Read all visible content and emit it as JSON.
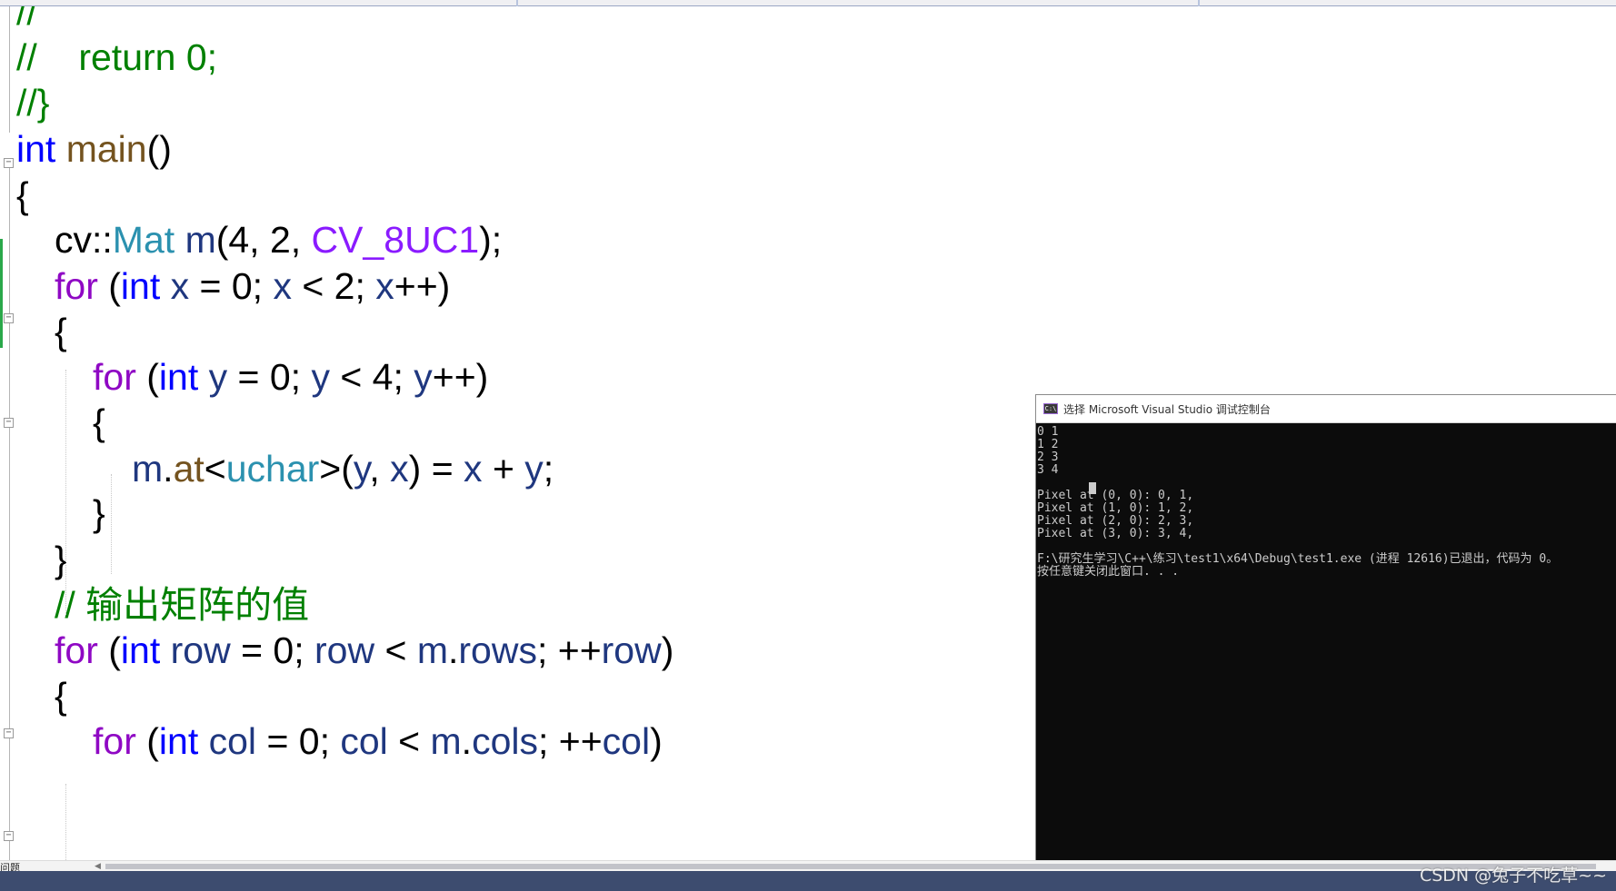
{
  "editor": {
    "lines": [
      [
        {
          "t": "//",
          "c": "cm"
        }
      ],
      [
        {
          "t": "//    return 0;",
          "c": "cm"
        }
      ],
      [
        {
          "t": "//}",
          "c": "cm"
        }
      ],
      [
        {
          "t": "int",
          "c": "kw"
        },
        {
          "t": " ",
          "c": "pl"
        },
        {
          "t": "main",
          "c": "fn"
        },
        {
          "t": "()",
          "c": "pl"
        }
      ],
      [
        {
          "t": "{",
          "c": "pl"
        }
      ],
      [
        {
          "t": "cv::",
          "c": "pl"
        },
        {
          "t": "Mat",
          "c": "ty"
        },
        {
          "t": " ",
          "c": "pl"
        },
        {
          "t": "m",
          "c": "var"
        },
        {
          "t": "(4, 2, ",
          "c": "pl"
        },
        {
          "t": "CV_8UC1",
          "c": "mac"
        },
        {
          "t": ");",
          "c": "pl"
        }
      ],
      [
        {
          "t": "for",
          "c": "ctl"
        },
        {
          "t": " (",
          "c": "pl"
        },
        {
          "t": "int",
          "c": "kw"
        },
        {
          "t": " ",
          "c": "pl"
        },
        {
          "t": "x",
          "c": "var"
        },
        {
          "t": " = 0; ",
          "c": "pl"
        },
        {
          "t": "x",
          "c": "var"
        },
        {
          "t": " < 2; ",
          "c": "pl"
        },
        {
          "t": "x",
          "c": "var"
        },
        {
          "t": "++)",
          "c": "pl"
        }
      ],
      [
        {
          "t": "{",
          "c": "pl"
        }
      ],
      [
        {
          "t": "for",
          "c": "ctl"
        },
        {
          "t": " (",
          "c": "pl"
        },
        {
          "t": "int",
          "c": "kw"
        },
        {
          "t": " ",
          "c": "pl"
        },
        {
          "t": "y",
          "c": "var"
        },
        {
          "t": " = 0; ",
          "c": "pl"
        },
        {
          "t": "y",
          "c": "var"
        },
        {
          "t": " < 4; ",
          "c": "pl"
        },
        {
          "t": "y",
          "c": "var"
        },
        {
          "t": "++)",
          "c": "pl"
        }
      ],
      [
        {
          "t": "{",
          "c": "pl"
        }
      ],
      [
        {
          "t": "m",
          "c": "var"
        },
        {
          "t": ".",
          "c": "pl"
        },
        {
          "t": "at",
          "c": "fn"
        },
        {
          "t": "<",
          "c": "pl"
        },
        {
          "t": "uchar",
          "c": "ty"
        },
        {
          "t": ">(",
          "c": "pl"
        },
        {
          "t": "y",
          "c": "var"
        },
        {
          "t": ", ",
          "c": "pl"
        },
        {
          "t": "x",
          "c": "var"
        },
        {
          "t": ") = ",
          "c": "pl"
        },
        {
          "t": "x",
          "c": "var"
        },
        {
          "t": " + ",
          "c": "pl"
        },
        {
          "t": "y",
          "c": "var"
        },
        {
          "t": ";",
          "c": "pl"
        }
      ],
      [
        {
          "t": "}",
          "c": "pl"
        }
      ],
      [
        {
          "t": "}",
          "c": "pl"
        }
      ],
      [
        {
          "t": "// 输出矩阵的值",
          "c": "cm"
        }
      ],
      [
        {
          "t": "for",
          "c": "ctl"
        },
        {
          "t": " (",
          "c": "pl"
        },
        {
          "t": "int",
          "c": "kw"
        },
        {
          "t": " ",
          "c": "pl"
        },
        {
          "t": "row",
          "c": "var"
        },
        {
          "t": " = 0; ",
          "c": "pl"
        },
        {
          "t": "row",
          "c": "var"
        },
        {
          "t": " < ",
          "c": "pl"
        },
        {
          "t": "m",
          "c": "var"
        },
        {
          "t": ".",
          "c": "pl"
        },
        {
          "t": "rows",
          "c": "var"
        },
        {
          "t": "; ++",
          "c": "pl"
        },
        {
          "t": "row",
          "c": "var"
        },
        {
          "t": ")",
          "c": "pl"
        }
      ],
      [
        {
          "t": "{",
          "c": "pl"
        }
      ],
      [
        {
          "t": "for",
          "c": "ctl"
        },
        {
          "t": " (",
          "c": "pl"
        },
        {
          "t": "int",
          "c": "kw"
        },
        {
          "t": " ",
          "c": "pl"
        },
        {
          "t": "col",
          "c": "var"
        },
        {
          "t": " = 0; ",
          "c": "pl"
        },
        {
          "t": "col",
          "c": "var"
        },
        {
          "t": " < ",
          "c": "pl"
        },
        {
          "t": "m",
          "c": "var"
        },
        {
          "t": ".",
          "c": "pl"
        },
        {
          "t": "cols",
          "c": "var"
        },
        {
          "t": "; ++",
          "c": "pl"
        },
        {
          "t": "col",
          "c": "var"
        },
        {
          "t": ")",
          "c": "pl"
        }
      ]
    ]
  },
  "console": {
    "title": "选择 Microsoft Visual Studio 调试控制台",
    "icon_label": "C:\\",
    "output_lines": [
      "0 1",
      "1 2",
      "2 3",
      "3 4",
      "",
      "Pixel at (0, 0): 0, 1,",
      "Pixel at (1, 0): 1, 2,",
      "Pixel at (2, 0): 2, 3,",
      "Pixel at (3, 0): 3, 4,",
      "",
      "F:\\研究生学习\\C++\\练习\\test1\\x64\\Debug\\test1.exe (进程 12616)已退出，代码为 0。",
      "按任意键关闭此窗口. . ."
    ]
  },
  "bottom": {
    "panel_label": "问题",
    "watermark": "CSDN @兔子不吃草~~"
  },
  "icons": {
    "fold": "collapse-icon",
    "console": "console-app-icon",
    "scroll_left": "scroll-left-arrow-icon"
  },
  "colors": {
    "comment": "#008000",
    "keyword": "#0000ff",
    "control": "#8f08c4",
    "function": "#74531f",
    "variable": "#1f377f",
    "type": "#2b91af",
    "macro": "#8a1bff",
    "console_bg": "#0c0c0c",
    "statusbar": "#3d4c6f"
  }
}
